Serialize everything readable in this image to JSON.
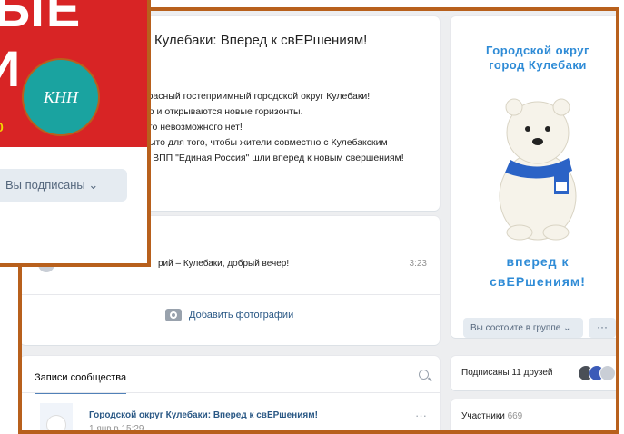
{
  "info": {
    "title": "Кулебаки: Вперед к свЕРшениям!",
    "lines": [
      "красный гостеприимный городской округ Кулебаки!",
      "но и открываются новые горизонты.",
      "его невозможного нет!",
      "рыто для того, чтобы жители совместно с Кулебакским",
      "м ВПП \"Единая Россия\" шли вперед к новым свершениям!"
    ]
  },
  "post": {
    "text": "рий  –  Кулебаки, добрый вечер!",
    "time": "3:23",
    "add_photo_label": "Добавить фотографии"
  },
  "wall": {
    "tab_label": "Записи сообщества",
    "post_title": "Городской округ Кулебаки: Вперед к свЕРшениям!",
    "post_date": "1 янв в 15:29",
    "more_label": "···"
  },
  "side": {
    "poster_line1": "Городской округ",
    "poster_line2": "город Кулебаки",
    "poster_line3": "вперед к",
    "poster_line4": "свЕРшениям!",
    "member_label": "Вы состоите в группе ⌄",
    "more_label": "···"
  },
  "friends": {
    "label": "Подписаны 11 друзей"
  },
  "members": {
    "label": "Участники",
    "count": "669"
  },
  "overlay": {
    "cover_text1": "ЫЕ",
    "cover_text2": "И",
    "cover_text3": "0",
    "logo_text": "КНН",
    "subscribed_label": "Вы подписаны ⌄"
  },
  "colors": {
    "frame": "#b8601c",
    "accent": "#2a5885",
    "cover": "#d82425"
  }
}
